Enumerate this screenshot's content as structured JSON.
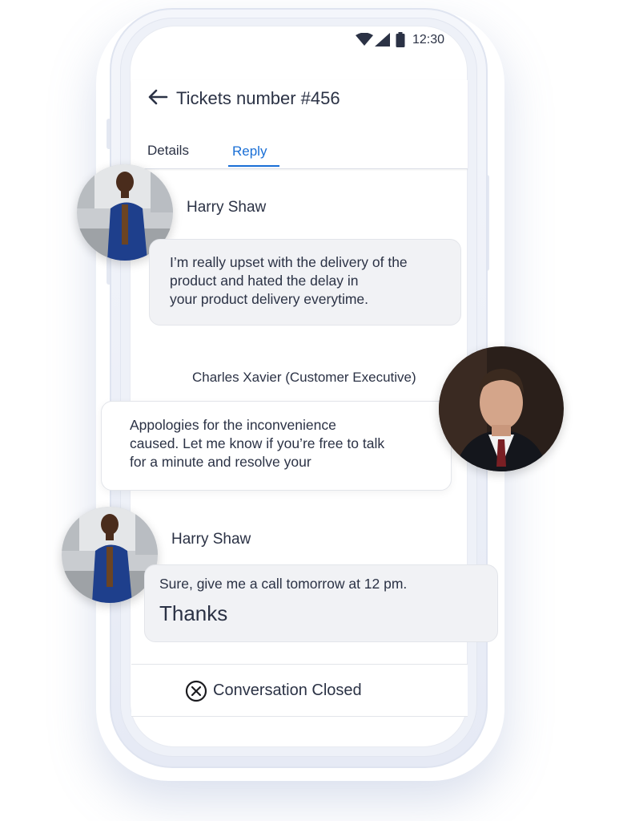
{
  "status_bar": {
    "time": "12:30",
    "icons": [
      "wifi-icon",
      "signal-icon",
      "battery-icon"
    ]
  },
  "header": {
    "back_icon": "arrow-left-icon",
    "title": "Tickets number #456",
    "tabs": [
      {
        "label": "Details",
        "active": false
      },
      {
        "label": "Reply",
        "active": true
      }
    ]
  },
  "messages": [
    {
      "sender": "Harry Shaw",
      "avatar": "harry-avatar",
      "lines": [
        "I’m really upset with the delivery of the",
        "product and hated the delay in",
        "your product delivery everytime."
      ]
    },
    {
      "sender": "Charles Xavier (Customer Executive)",
      "avatar": "charles-avatar",
      "lines": [
        "Appologies for the inconvenience",
        "caused. Let me know if you’re free to talk",
        "for a minute and resolve your"
      ]
    },
    {
      "sender": "Harry Shaw",
      "avatar": "harry-avatar",
      "lines": [
        "Sure, give me a call tomorrow at 12 pm."
      ],
      "emphasis": "Thanks"
    }
  ],
  "footer": {
    "icon": "close-circle-icon",
    "label": "Conversation Closed"
  },
  "colors": {
    "accent": "#1a6fd6",
    "text": "#2b3245",
    "bubble": "#f1f2f5"
  }
}
